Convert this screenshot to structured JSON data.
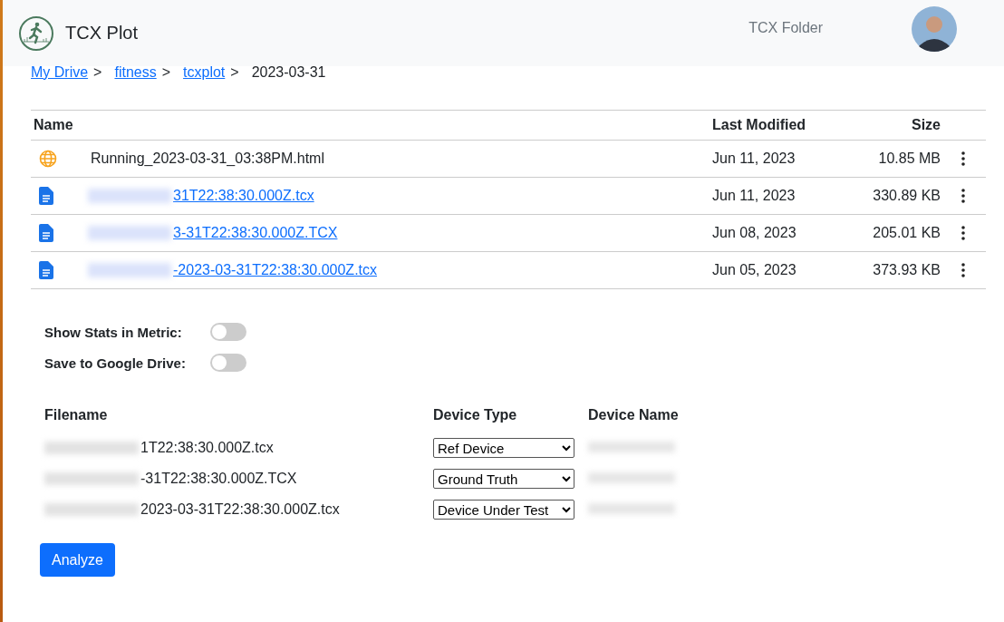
{
  "header": {
    "title": "TCX Plot",
    "nav_link": "TCX Folder"
  },
  "breadcrumb": [
    {
      "label": "My Drive",
      "link": true
    },
    {
      "label": "fitness",
      "link": true
    },
    {
      "label": "tcxplot",
      "link": true
    },
    {
      "label": "2023-03-31",
      "link": false
    }
  ],
  "breadcrumb_separator": ">",
  "file_table": {
    "columns": [
      "Name",
      "Last Modified",
      "Size"
    ],
    "rows": [
      {
        "kind": "html",
        "name": "Running_2023-03-31_03:38PM.html",
        "blurred": false,
        "modified": "Jun 11, 2023",
        "size": "10.85 MB"
      },
      {
        "kind": "tcx",
        "name": "31T22:38:30.000Z.tcx",
        "blurred": true,
        "modified": "Jun 11, 2023",
        "size": "330.89 KB"
      },
      {
        "kind": "tcx",
        "name": "3-31T22:38:30.000Z.TCX",
        "blurred": true,
        "modified": "Jun 08, 2023",
        "size": "205.01 KB"
      },
      {
        "kind": "tcx",
        "name": "-2023-03-31T22:38:30.000Z.tcx",
        "blurred": true,
        "modified": "Jun 05, 2023",
        "size": "373.93 KB"
      }
    ]
  },
  "settings": [
    {
      "label": "Show Stats in Metric:",
      "on": false
    },
    {
      "label": "Save to Google Drive:",
      "on": false
    }
  ],
  "device_table": {
    "columns": [
      "Filename",
      "Device Type",
      "Device Name"
    ],
    "rows": [
      {
        "filename": "1T22:38:30.000Z.tcx",
        "device_type": "Ref Device"
      },
      {
        "filename": "-31T22:38:30.000Z.TCX",
        "device_type": "Ground Truth"
      },
      {
        "filename": "2023-03-31T22:38:30.000Z.tcx",
        "device_type": "Device Under Test"
      }
    ]
  },
  "analyze_button": "Analyze"
}
